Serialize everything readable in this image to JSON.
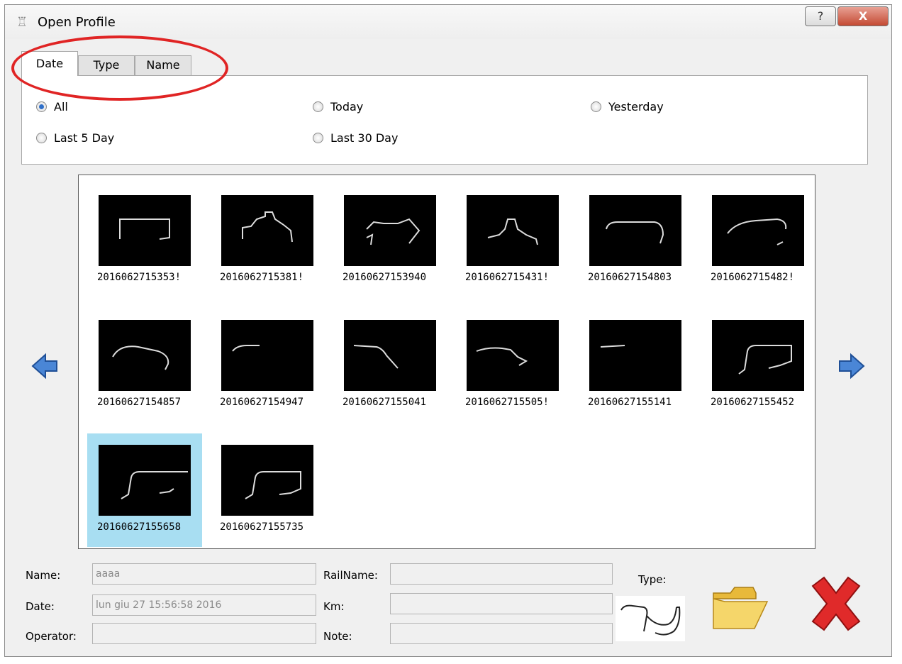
{
  "window": {
    "title": "Open Profile",
    "help_label": "?",
    "close_label": "X"
  },
  "tabs": [
    {
      "label": "Date"
    },
    {
      "label": "Type"
    },
    {
      "label": "Name"
    }
  ],
  "filters": {
    "selected": "All",
    "options": [
      {
        "label": "All"
      },
      {
        "label": "Today"
      },
      {
        "label": "Yesterday"
      },
      {
        "label": "Last 5 Day"
      },
      {
        "label": "Last 30 Day"
      }
    ]
  },
  "gallery": {
    "items": [
      {
        "label": "2016062715353!"
      },
      {
        "label": "2016062715381!"
      },
      {
        "label": "20160627153940"
      },
      {
        "label": "2016062715431!"
      },
      {
        "label": "20160627154803"
      },
      {
        "label": "2016062715482!"
      },
      {
        "label": "20160627154857"
      },
      {
        "label": "20160627154947"
      },
      {
        "label": "20160627155041"
      },
      {
        "label": "2016062715505!"
      },
      {
        "label": "20160627155141"
      },
      {
        "label": "20160627155452"
      },
      {
        "label": "20160627155658",
        "selected": true
      },
      {
        "label": "20160627155735"
      }
    ]
  },
  "details": {
    "name_label": "Name:",
    "name_value": "aaaa",
    "date_label": "Date:",
    "date_value": "lun giu 27 15:56:58 2016",
    "operator_label": "Operator:",
    "operator_value": "",
    "railname_label": "RailName:",
    "railname_value": "",
    "km_label": "Km:",
    "km_value": "",
    "note_label": "Note:",
    "note_value": "",
    "type_label": "Type:"
  },
  "colors": {
    "selection": "#a8def2",
    "annotation": "#e02424",
    "radio_dot": "#2f6fc8",
    "arrow_blue": "#4a86d6"
  },
  "icons": [
    "app-icon",
    "help-icon",
    "close-icon",
    "prev-arrow-icon",
    "next-arrow-icon",
    "open-folder-icon",
    "cancel-x-icon"
  ]
}
